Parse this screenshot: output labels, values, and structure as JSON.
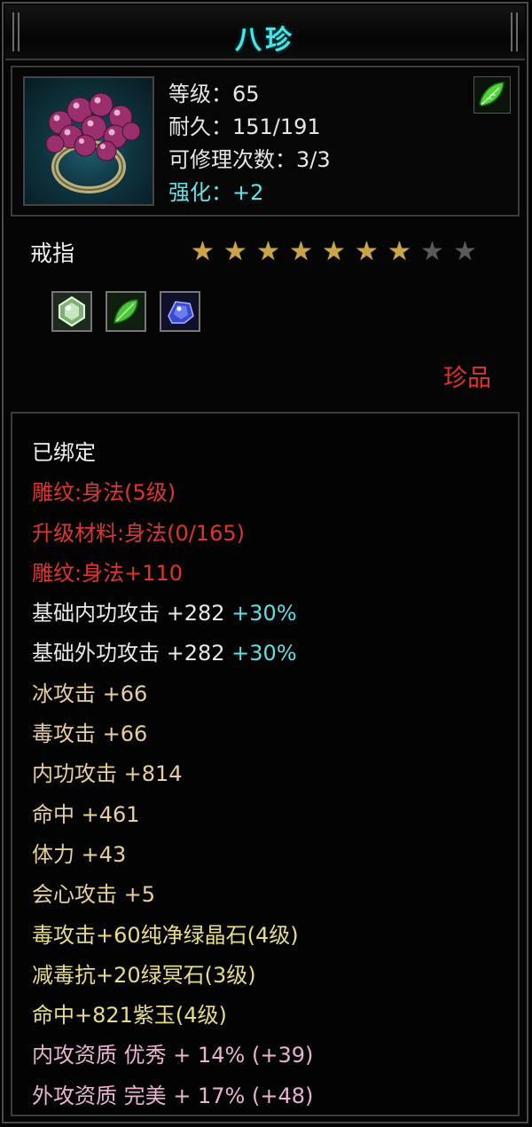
{
  "window": {
    "title": "八珍"
  },
  "header": {
    "icon": "ring-icon",
    "badge_icon": "leaf-icon",
    "level": "等级：65",
    "durability": "耐久：151/191",
    "repairs": "可修理次数：3/3",
    "enhance": "强化：+2"
  },
  "item": {
    "type": "戒指",
    "stars_lit": 7,
    "stars_total": 9,
    "rarity": "珍品",
    "gems": [
      {
        "icon": "white-green-gem-icon",
        "color": "#c8e6c0"
      },
      {
        "icon": "green-leaf-gem-icon",
        "color": "#5fd94a"
      },
      {
        "icon": "blue-crystal-gem-icon",
        "color": "#4a5fe0"
      }
    ]
  },
  "colors": {
    "title": "#49e3e8",
    "enhance": "#5fe4ea",
    "rarity": "#e0332b",
    "star_on": "#c9a44a",
    "star_off": "#5a5a5a",
    "red_text": "#e0342c",
    "tan_text": "#e8cf9a",
    "gold_text": "#e9dc86",
    "pink_text": "#e8b2d2",
    "cyan_text": "#5fdfe6"
  },
  "attributes": {
    "bound": "已绑定",
    "engrave": "雕纹:身法(5级)",
    "upgrade_material": "升级材料:身法(0/165)",
    "engrave_bonus": "雕纹:身法+110",
    "base_inner_attack": "基础内功攻击  +282",
    "base_inner_attack_pct": " +30%",
    "base_outer_attack": "基础外功攻击  +282",
    "base_outer_attack_pct": " +30%",
    "ice_attack": "冰攻击  +66",
    "poison_attack": "毒攻击  +66",
    "inner_attack": "内功攻击  +814",
    "accuracy": "命中  +461",
    "stamina": "体力  +43",
    "crit_attack": "会心攻击  +5",
    "gem1": "毒攻击+60纯净绿晶石(4级)",
    "gem2": "减毒抗+20绿冥石(3级)",
    "gem3": "命中+821紫玉(4级)",
    "inner_quality": "内攻资质  优秀  + 14% (+39)",
    "outer_quality": "外攻资质  完美  + 17% (+48)"
  }
}
